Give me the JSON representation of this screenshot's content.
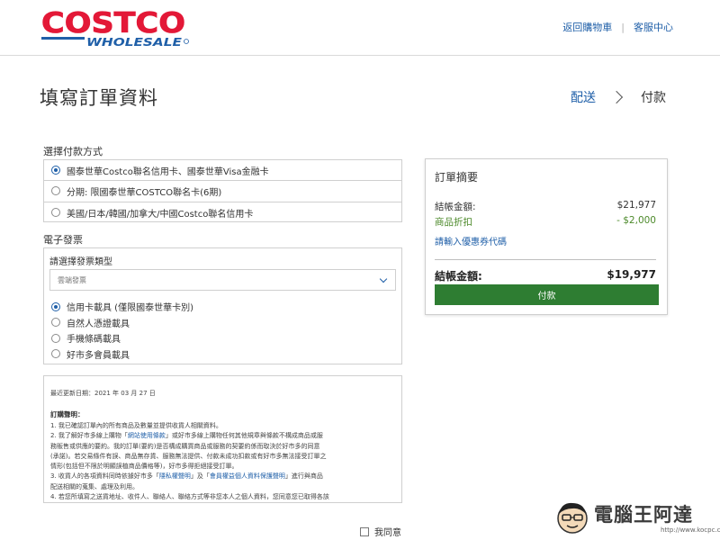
{
  "header": {
    "brand_top": "COSTCO",
    "brand_bottom": "WHOLESALE",
    "links": [
      "返回購物車",
      "客服中心"
    ]
  },
  "page": {
    "title": "填寫訂單資料",
    "steps": {
      "previous": "配送",
      "current": "付款"
    }
  },
  "payment": {
    "label": "選擇付款方式",
    "options": [
      {
        "label": "國泰世華Costco聯名信用卡、國泰世華Visa金融卡",
        "selected": true
      },
      {
        "label": "分期: 限國泰世華COSTCO聯名卡(6期)",
        "selected": false
      },
      {
        "label": "美國/日本/韓國/加拿大/中國Costco聯名信用卡",
        "selected": false
      }
    ]
  },
  "invoice": {
    "label": "電子發票",
    "type_label": "請選擇發票類型",
    "select_value": "雲端發票",
    "options": [
      {
        "label": "信用卡載具 (僅限國泰世華卡別)",
        "selected": true
      },
      {
        "label": "自然人憑證載具",
        "selected": false
      },
      {
        "label": "手機條碼載具",
        "selected": false
      },
      {
        "label": "好市多會員載具",
        "selected": false
      }
    ]
  },
  "terms": {
    "updated": "最近更新日期：2021 年 03 月 27 日",
    "heading": "訂購聲明：",
    "line1": "1. 我已確認訂單內的所有商品及數量並提供收貨人相關資料。",
    "line2a": "2. 我了解好市多線上購物「",
    "line2_link": "網站使用條款",
    "line2b": "」或好市多線上購物任何其他規章與條款不構成商品或服",
    "line3": "務販售或供應的要約。我的訂單(要約)是否構成購買商品或服務的契要約係而取決於好市多的同意",
    "line4": "(承諾)。若交易條件有誤、商品無存貨、服務無法提供、付款未成功扣款或有好市多無法接受訂單之",
    "line5": "情形(包括但不限於明顯誤植商品價格等)，好市多得拒絕接受訂單。",
    "line6a": "3. 收貨人的各項資料同時依據好市多「",
    "line6_link1": "隱私權聲明",
    "line6b": "」及「",
    "line6_link2": "會員權益個人資料保護聲明",
    "line6c": "」進行與商品",
    "line7": "配送相關的蒐集、處理及利用。",
    "line8": "4. 若您所填寫之送貨地址、收件人、聯絡人、聯絡方式等非您本人之個人資料，您同意您已取得各該"
  },
  "agree": {
    "label": "我同意",
    "checked": false
  },
  "summary": {
    "title": "訂單摘要",
    "subtotal_label": "結帳金額:",
    "subtotal_value": "$21,977",
    "discount_label": "商品折扣",
    "discount_value": "- $2,000",
    "coupon_link": "請輸入優惠券代碼",
    "total_label": "結帳金額:",
    "total_value": "$19,977",
    "pay_button": "付款"
  },
  "watermark": {
    "text": "電腦王阿達",
    "url": "http://www.kocpc.com.tw"
  },
  "colors": {
    "costco_red": "#e31837",
    "costco_blue": "#1f5fa8",
    "pay_green": "#2e7d32",
    "discount_green": "#4d8a2b"
  }
}
